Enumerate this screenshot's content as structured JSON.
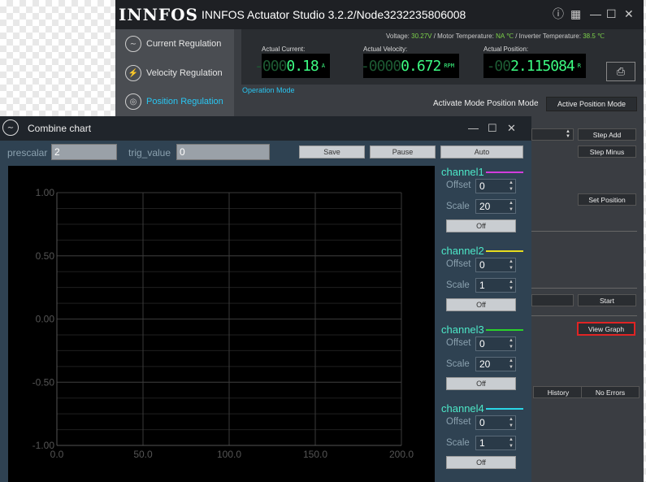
{
  "app": {
    "logo": "INNFOS",
    "title": "INNFOS Actuator Studio 3.2.2/Node3232235806008",
    "window_controls": [
      "info-icon",
      "grid-icon",
      "minimize-icon",
      "maximize-icon",
      "close-icon"
    ]
  },
  "sidebar": {
    "items": [
      {
        "label": "Current Regulation",
        "icon": "current-icon",
        "active": false
      },
      {
        "label": "Velocity Regulation",
        "icon": "velocity-icon",
        "active": false
      },
      {
        "label": "Position Regulation",
        "icon": "position-icon",
        "active": true
      }
    ]
  },
  "status": {
    "voltage_label": "Voltage:",
    "voltage": "30.27V",
    "motor_temp_label": "Motor Temperature:",
    "motor_temp": "NA ℃",
    "inverter_temp_label": "Inverter Temperature:",
    "inverter_temp": "38.5 ℃",
    "readouts": [
      {
        "label": "Actual Current:",
        "dim": "-000",
        "lit": "0.18",
        "unit": "A"
      },
      {
        "label": "Actual Velocity:",
        "dim": "-0000",
        "lit": "0.672",
        "unit": "RPM"
      },
      {
        "label": "Actual Position:",
        "dim": "-00",
        "lit": "2.115084",
        "unit": "R"
      }
    ]
  },
  "operation": {
    "section_label": "Operation Mode",
    "activate_label": "Activate Mode Position Mode",
    "mode_button": "Active Position Mode"
  },
  "right_panel": {
    "step_add": "Step Add",
    "step_minus": "Step Minus",
    "set_position": "Set Position",
    "start": "Start",
    "view_graph": "View Graph",
    "history": "History",
    "no_errors": "No Errors"
  },
  "chart_window": {
    "title": "Combine chart",
    "prescalar_label": "prescalar",
    "prescalar_value": "2",
    "trig_label": "trig_value",
    "trig_value": "0",
    "save": "Save",
    "pause": "Pause",
    "auto": "Auto"
  },
  "chart_data": {
    "type": "line",
    "title": "",
    "xlabel": "",
    "ylabel": "",
    "xlim": [
      0,
      200
    ],
    "ylim": [
      -1.0,
      1.0
    ],
    "x_ticks": [
      "0.0",
      "50.0",
      "100.0",
      "150.0",
      "200.0"
    ],
    "y_ticks": [
      "1.00",
      "0.50",
      "0.00",
      "-0.50",
      "-1.00"
    ],
    "grid": true,
    "series": []
  },
  "channels": [
    {
      "name": "channel1",
      "color": "#d23cdc",
      "offset_label": "Offset",
      "offset": "0",
      "scale_label": "Scale",
      "scale": "20",
      "off": "Off"
    },
    {
      "name": "channel2",
      "color": "#e6dc1e",
      "offset_label": "Offset",
      "offset": "0",
      "scale_label": "Scale",
      "scale": "1",
      "off": "Off"
    },
    {
      "name": "channel3",
      "color": "#2ad22a",
      "offset_label": "Offset",
      "offset": "0",
      "scale_label": "Scale",
      "scale": "20",
      "off": "Off"
    },
    {
      "name": "channel4",
      "color": "#2ad6e6",
      "offset_label": "Offset",
      "offset": "0",
      "scale_label": "Scale",
      "scale": "1",
      "off": "Off"
    }
  ]
}
